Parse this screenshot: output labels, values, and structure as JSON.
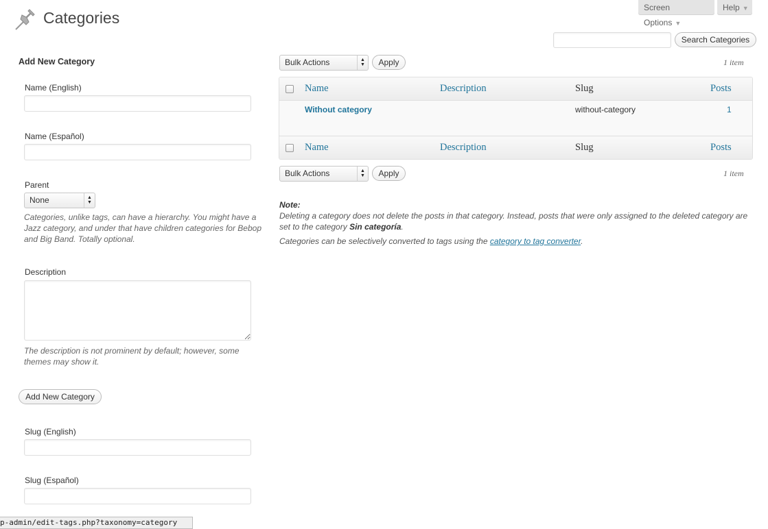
{
  "header": {
    "title": "Categories",
    "screen_options_label": "Screen Options",
    "help_label": "Help"
  },
  "search": {
    "value": "",
    "button_label": "Search Categories"
  },
  "add_form": {
    "heading": "Add New Category",
    "name_en_label": "Name (English)",
    "name_en_value": "",
    "name_es_label": "Name (Español)",
    "name_es_value": "",
    "parent_label": "Parent",
    "parent_selected": "None",
    "parent_help": "Categories, unlike tags, can have a hierarchy. You might have a Jazz category, and under that have children categories for Bebop and Big Band. Totally optional.",
    "description_label": "Description",
    "description_value": "",
    "description_help": "The description is not prominent by default; however, some themes may show it.",
    "submit_label": "Add New Category",
    "slug_en_label": "Slug (English)",
    "slug_en_value": "",
    "slug_es_label": "Slug (Español)",
    "slug_es_value": ""
  },
  "table": {
    "bulk_actions_label": "Bulk Actions",
    "apply_label": "Apply",
    "item_count": "1 item",
    "columns": [
      "Name",
      "Description",
      "Slug",
      "Posts"
    ],
    "rows": [
      {
        "name": "Without category",
        "description": "",
        "slug": "without-category",
        "posts": "1"
      }
    ]
  },
  "notes": {
    "note_label": "Note:",
    "note_text_1": "Deleting a category does not delete the posts in that category. Instead, posts that were only assigned to the deleted category are set to the category ",
    "note_default_category": "Sin categoría",
    "note_text_2": ".",
    "convert_text": "Categories can be selectively converted to tags using the ",
    "convert_link": "category to tag converter",
    "convert_end": "."
  },
  "status_bar": {
    "url": "p-admin/edit-tags.php?taxonomy=category"
  },
  "colors": {
    "link": "#21759b",
    "heading": "#464646"
  },
  "icons": {
    "title_icon": "pushpin-icon"
  }
}
